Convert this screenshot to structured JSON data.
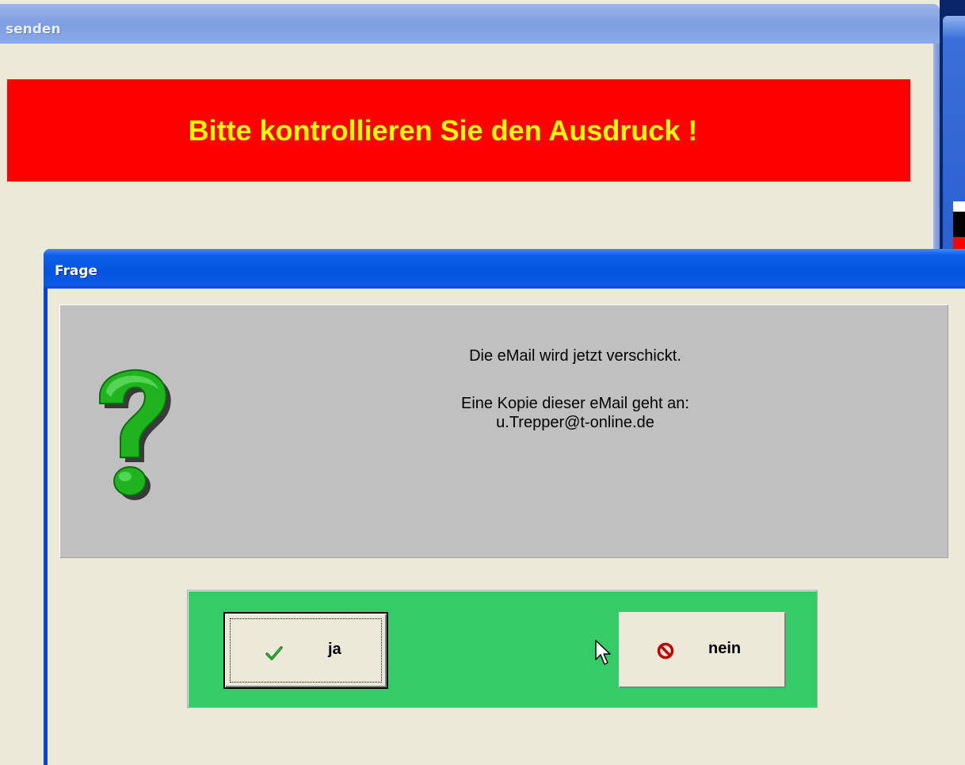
{
  "background_window": {
    "title": "senden",
    "banner_text": "Bitte kontrollieren Sie den Ausdruck !",
    "banner_color": "#ff0000",
    "banner_text_color": "#ffff00"
  },
  "dialog": {
    "title": "Frage",
    "icon": "question-mark-icon",
    "message_line1": "Die eMail wird jetzt verschickt.",
    "message_line2": "Eine Kopie dieser eMail geht an:",
    "message_line3": "u.Trepper@t-online.de",
    "button_panel_color": "#33cc66",
    "buttons": {
      "yes": {
        "label": "ja",
        "icon": "checkmark-icon"
      },
      "no": {
        "label": "nein",
        "icon": "no-entry-icon"
      }
    }
  },
  "cursor": "arrow-cursor-icon"
}
